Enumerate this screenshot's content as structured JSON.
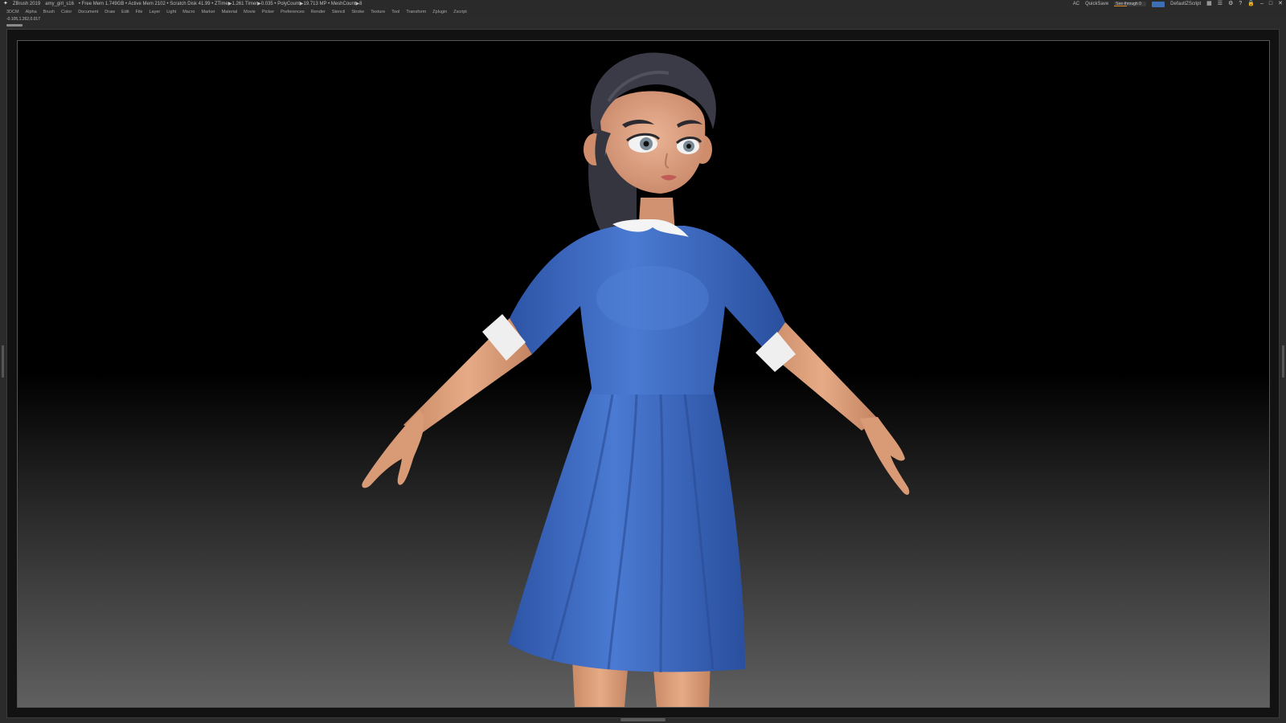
{
  "titlebar": {
    "app": "ZBrush 2019",
    "file": "amy_girl_s16",
    "stats": "• Free Mem 1.749GB • Active Mem 2102 • Scratch Disk 41.99 • ZTime▶1.261 Timer▶0.035 • PolyCount▶19.713 MP • MeshCount▶8",
    "ac": "AC",
    "quicksave": "QuickSave",
    "see_through": "See-through 0",
    "script": "DefaultZScript"
  },
  "menu": [
    "3DCM",
    "Alpha",
    "Brush",
    "Color",
    "Document",
    "Draw",
    "Edit",
    "File",
    "Layer",
    "Light",
    "Macro",
    "Marker",
    "Material",
    "Movie",
    "Picker",
    "Preferences",
    "Render",
    "Stencil",
    "Stroke",
    "Texture",
    "Tool",
    "Transform",
    "Zplugin",
    "Zscript"
  ],
  "coords": "-0.105,1.262,0.017",
  "colors": {
    "dress": "#3e6cc4",
    "skin": "#e0a27c",
    "hair": "#3a3b47",
    "collar": "#f2f2f2"
  }
}
